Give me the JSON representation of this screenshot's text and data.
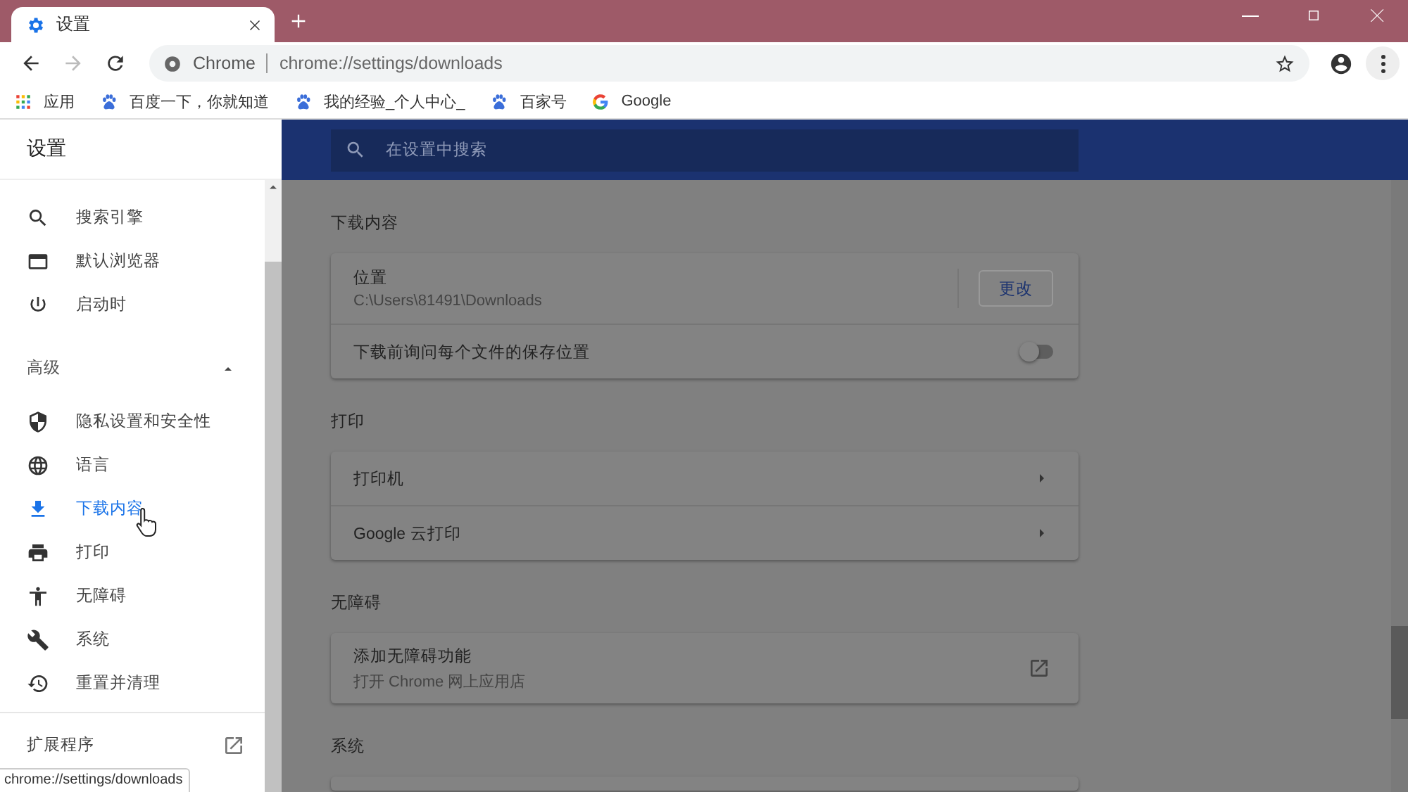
{
  "tabs": [
    {
      "title": "设置",
      "selected": true
    }
  ],
  "address_bar": {
    "site": "Chrome",
    "url": "chrome://settings/downloads"
  },
  "bookmarks": [
    {
      "label": "应用",
      "kind": "apps"
    },
    {
      "label": "百度一下，你就知道",
      "kind": "paw"
    },
    {
      "label": "我的经验_个人中心_",
      "kind": "paw"
    },
    {
      "label": "百家号",
      "kind": "paw"
    },
    {
      "label": "Google",
      "kind": "google"
    }
  ],
  "sidebar": {
    "title": "设置",
    "items": [
      {
        "label": "搜索引擎",
        "selected": false
      },
      {
        "label": "默认浏览器",
        "selected": false
      },
      {
        "label": "启动时",
        "selected": false
      }
    ],
    "advanced": {
      "label": "高级",
      "expanded": true
    },
    "advanced_items": [
      {
        "label": "隐私设置和安全性",
        "selected": false
      },
      {
        "label": "语言",
        "selected": false
      },
      {
        "label": "下载内容",
        "selected": true
      },
      {
        "label": "打印",
        "selected": false
      },
      {
        "label": "无障碍",
        "selected": false
      },
      {
        "label": "系统",
        "selected": false
      },
      {
        "label": "重置并清理",
        "selected": false
      }
    ],
    "extensions": "扩展程序"
  },
  "search": {
    "placeholder": "在设置中搜索"
  },
  "sections": [
    {
      "title": "下载内容",
      "rows": [
        {
          "kind": "location",
          "label": "位置",
          "value": "C:\\Users\\81491\\Downloads",
          "button": "更改"
        },
        {
          "kind": "toggle",
          "label": "下载前询问每个文件的保存位置",
          "on": false
        }
      ]
    },
    {
      "title": "打印",
      "rows": [
        {
          "kind": "link",
          "label": "打印机"
        },
        {
          "kind": "link",
          "label": "Google 云打印"
        }
      ]
    },
    {
      "title": "无障碍",
      "rows": [
        {
          "kind": "external",
          "label": "添加无障碍功能",
          "value": "打开 Chrome 网上应用店"
        }
      ]
    },
    {
      "title": "系统"
    }
  ],
  "status_bar": {
    "url": "chrome://settings/downloads"
  }
}
